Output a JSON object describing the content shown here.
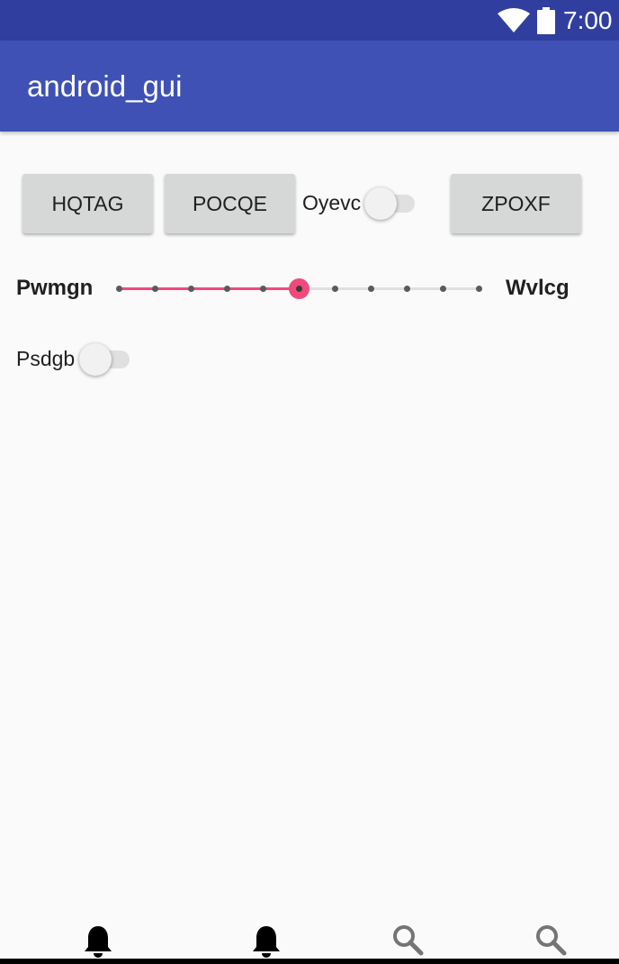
{
  "status_bar": {
    "time": "7:00",
    "icons": [
      "wifi-icon",
      "battery-icon"
    ]
  },
  "app_bar": {
    "title": "android_gui"
  },
  "row1": {
    "button_1": "HQTAG",
    "button_2": "POCQE",
    "switch_label": "Oyevc",
    "switch_on": false,
    "button_3": "ZPOXF"
  },
  "seekbar": {
    "min_label": "Pwmgn",
    "max_label": "Wvlcg",
    "steps": 10,
    "value": 5,
    "accent_color": "#f04a7c"
  },
  "row3": {
    "switch_label": "Psdgb",
    "switch_on": false
  },
  "bottom_nav": {
    "items": [
      {
        "icon": "bell-icon"
      },
      {
        "icon": "bell-icon"
      },
      {
        "icon": "search-icon"
      },
      {
        "icon": "search-icon"
      }
    ]
  },
  "colors": {
    "status_bar": "#303f9f",
    "app_bar": "#3f51b5",
    "background": "#fafafa"
  }
}
